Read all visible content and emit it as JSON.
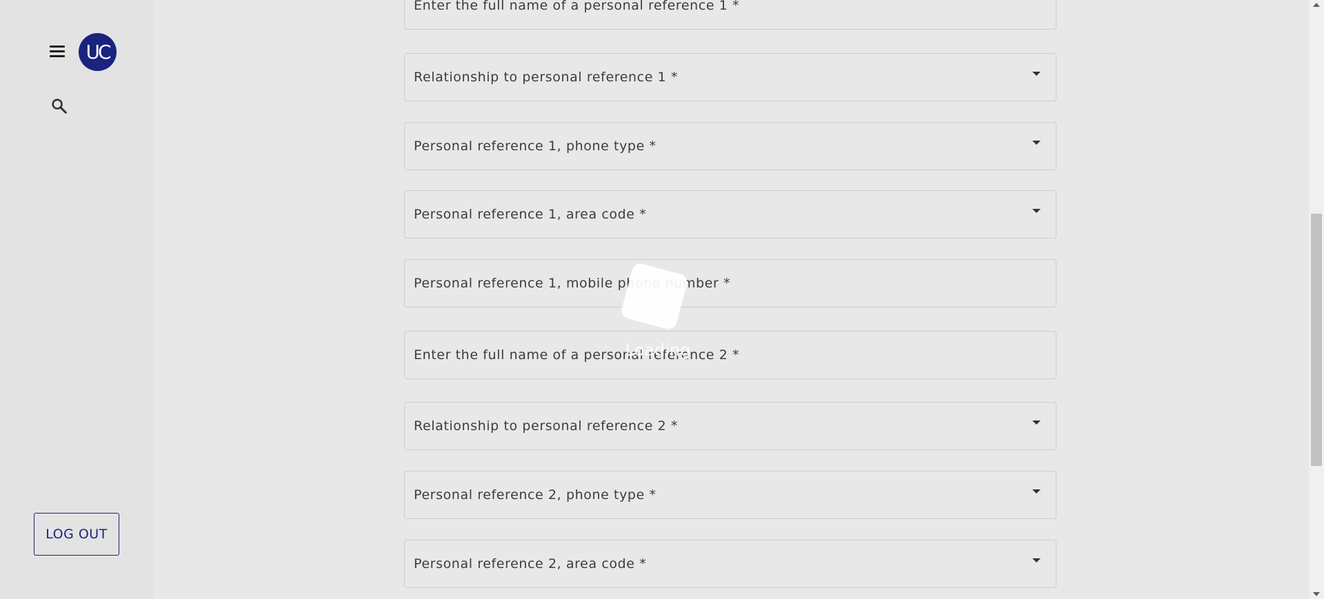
{
  "sidebar": {
    "avatar_text": "UC",
    "menu_icon": "hamburger-menu-icon",
    "search_icon": "search-icon",
    "logout_label": "LOG OUT"
  },
  "form": {
    "fields": [
      {
        "label": "Enter the full name of a personal reference 1 *",
        "type": "text"
      },
      {
        "label": "Relationship to personal reference 1 *",
        "type": "select"
      },
      {
        "label": "Personal reference 1, phone type *",
        "type": "select"
      },
      {
        "label": "Personal reference 1, area code *",
        "type": "select"
      },
      {
        "label": "Personal reference 1, mobile phone number *",
        "type": "text"
      },
      {
        "label": "Enter the full name of a personal reference 2 *",
        "type": "text"
      },
      {
        "label": "Relationship to personal reference 2 *",
        "type": "select"
      },
      {
        "label": "Personal reference 2, phone type *",
        "type": "select"
      },
      {
        "label": "Personal reference 2, area code *",
        "type": "select"
      }
    ]
  },
  "loading_overlay": {
    "text": "Loading"
  },
  "colors": {
    "accent": "#1a237e",
    "background": "#e8e8e8",
    "sidebar": "#e3e3e3"
  }
}
